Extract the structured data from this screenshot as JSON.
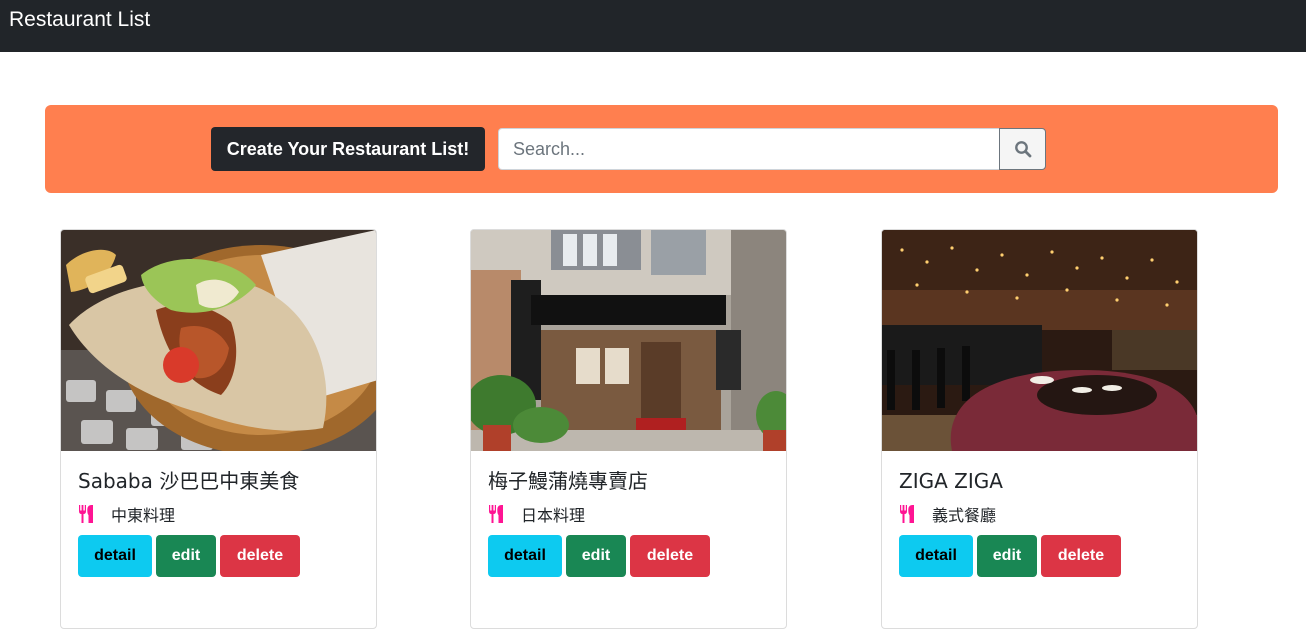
{
  "navbar": {
    "brand": "Restaurant List"
  },
  "banner": {
    "create_label": "Create Your Restaurant List!",
    "search_placeholder": "Search...",
    "search_value": ""
  },
  "restaurants": [
    {
      "name": "Sababa 沙巴巴中東美食",
      "category": "中東料理",
      "detail_label": "detail",
      "edit_label": "edit",
      "delete_label": "delete"
    },
    {
      "name": "梅子鰻蒲燒專賣店",
      "category": "日本料理",
      "detail_label": "detail",
      "edit_label": "edit",
      "delete_label": "delete"
    },
    {
      "name": "ZIGA ZIGA",
      "category": "義式餐廳",
      "detail_label": "detail",
      "edit_label": "edit",
      "delete_label": "delete"
    }
  ],
  "colors": {
    "navbar": "#212529",
    "banner": "#ff7f4f",
    "category_icon": "#ff1493",
    "detail": "#0dcaf0",
    "edit": "#198754",
    "delete": "#dc3545"
  },
  "icons": {
    "search": "magnifier-icon",
    "category": "utensils-icon"
  }
}
